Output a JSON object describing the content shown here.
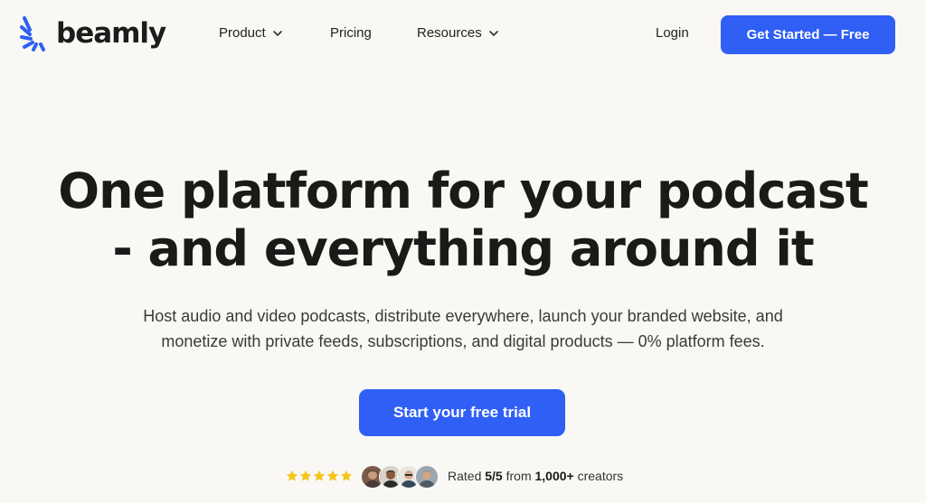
{
  "brand": {
    "name": "beamly",
    "accent": "#2f5ff5",
    "logo_icon": "sunburst-logo-icon"
  },
  "nav": {
    "items": [
      {
        "label": "Product",
        "has_dropdown": true,
        "icon": "chevron-down-icon"
      },
      {
        "label": "Pricing",
        "has_dropdown": false
      },
      {
        "label": "Resources",
        "has_dropdown": true,
        "icon": "chevron-down-icon"
      }
    ],
    "login_label": "Login",
    "cta_label": "Get Started — Free"
  },
  "hero": {
    "headline_line1": "One platform for your podcast",
    "headline_line2": "- and everything around it",
    "subtitle_line1": "Host audio and video podcasts, distribute everywhere, launch your branded website, and",
    "subtitle_line2": "monetize with private feeds, subscriptions, and digital products — 0% platform fees.",
    "cta_label": "Start your free trial"
  },
  "rating": {
    "stars": 5,
    "star_color": "#f5c518",
    "prefix": "Rated",
    "score": "5/5",
    "middle": "from",
    "count": "1,000+",
    "suffix": "creators",
    "avatars": [
      "creator-avatar-1",
      "creator-avatar-2",
      "creator-avatar-3",
      "creator-avatar-4"
    ]
  }
}
